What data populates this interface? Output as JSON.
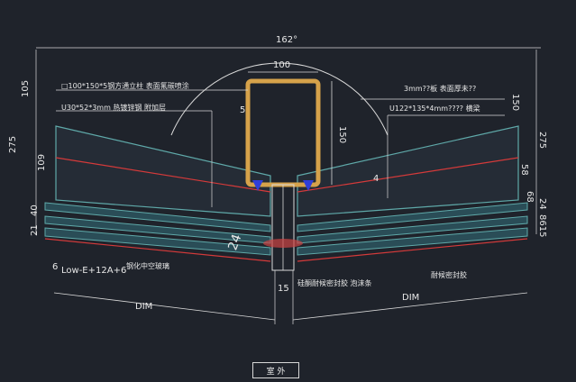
{
  "colors": {
    "background": "#1f232b",
    "linework": "#d9d9d9",
    "glass_band": "#5fa9a9",
    "seal_red": "#d43a3a",
    "steel_tube": "#d6a24a",
    "bracket_blue": "#2f3fd8"
  },
  "dimensions": {
    "angle": "162°",
    "tube_width": "100",
    "tube_wall": "5",
    "tube_height": "150",
    "left_vertical": [
      "105",
      "275",
      "109",
      "40",
      "21"
    ],
    "right_vertical": [
      "150",
      "275",
      "58",
      "68",
      "24",
      "8615"
    ],
    "joint_width": "15",
    "joint_height": "24",
    "joint_marker": "4",
    "left_dim": "DIM",
    "right_dim": "DIM"
  },
  "annotations": {
    "steel_tube_spec": "□100*150*5钢方通立柱 表面氟碳喷涂",
    "left_profile_spec": "U30*52*3mm 热镀锌钢 附加层",
    "right_thickness_note": "3mm??板 表面厚未??",
    "right_profile_spec": "U122*135*4mm???? 横梁",
    "glass_spec_main": "Low-E+12A+6",
    "glass_spec_prefix": "6",
    "glass_spec_suffix": "钢化中空玻璃",
    "sealant_note": "硅酮耐候密封胶 泡沫条",
    "right_sealant_note": "耐候密封胶"
  },
  "bottom_tag": "室 外"
}
